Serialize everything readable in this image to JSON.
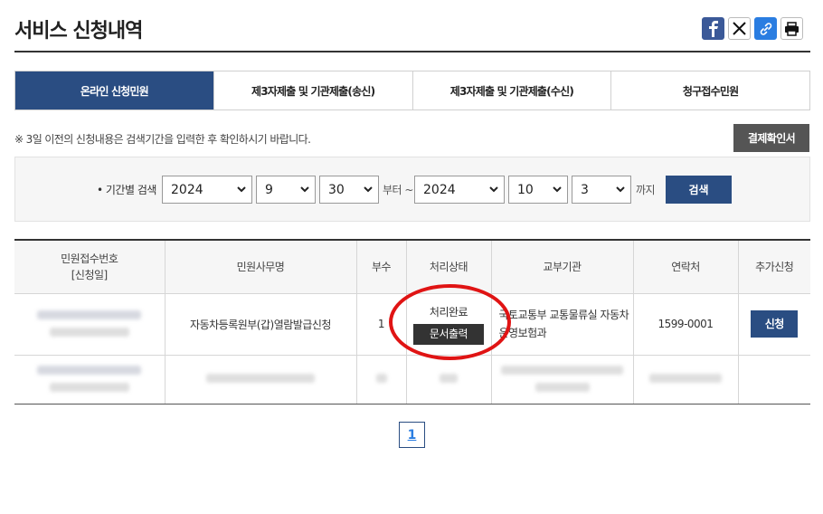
{
  "page": {
    "title": "서비스 신청내역"
  },
  "share": [
    {
      "name": "facebook-icon"
    },
    {
      "name": "x-icon"
    },
    {
      "name": "link-icon"
    },
    {
      "name": "print-icon"
    }
  ],
  "tabs": [
    {
      "label": "온라인 신청민원",
      "active": true
    },
    {
      "label": "제3자제출 및 기관제출(송신)",
      "active": false
    },
    {
      "label": "제3자제출 및 기관제출(수신)",
      "active": false
    },
    {
      "label": "청구접수민원",
      "active": false
    }
  ],
  "notice": "※ 3일 이전의 신청내용은 검색기간을 입력한 후 확인하시기 바랍니다.",
  "confirm_button": "결제확인서",
  "search": {
    "label": "• 기간별 검색",
    "from": {
      "year": "2024",
      "month": "9",
      "day": "30"
    },
    "from_suffix": "부터 ~",
    "to": {
      "year": "2024",
      "month": "10",
      "day": "3"
    },
    "to_suffix": "까지",
    "button": "검색"
  },
  "table": {
    "headers": {
      "receipt_no": "민원접수번호",
      "receipt_date": "[신청일]",
      "service_name": "민원사무명",
      "copies": "부수",
      "status": "처리상태",
      "agency": "교부기관",
      "contact": "연락처",
      "extra": "추가신청"
    },
    "rows": [
      {
        "service_name": "자동차등록원부(갑)열람발급신청",
        "copies": "1",
        "status": "처리완료",
        "print_button": "문서출력",
        "agency": "국토교통부 교통물류실 자동차운영보험과",
        "contact": "1599-0001",
        "apply_button": "신청"
      }
    ]
  },
  "pagination": {
    "current": "1"
  },
  "colors": {
    "primary": "#2a4d82",
    "highlight_ring": "#e01414",
    "dark_button": "#333333"
  }
}
